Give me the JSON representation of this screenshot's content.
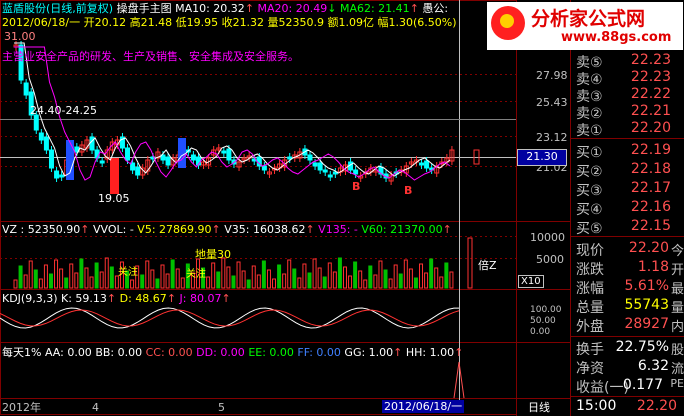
{
  "header": {
    "stock_name": "蓝盾股份(日线,前复权)",
    "chart_name": "操盘手主图",
    "ma10": "MA10: 20.32",
    "ma20": "MA20: 20.49",
    "ma62": "MA62: 21.41",
    "tail": "愚公:",
    "line2": "2012/06/18/一 开20.12 高21.48 低19.95 收21.32 量52350.9 额1.09亿 幅1.30(6.50%)",
    "business": "主营业安全产品的研发、生产及销售、安全集成及安全服务。",
    "top_price": "31.00"
  },
  "price_axis": [
    "27.98",
    "25.43",
    "23.12",
    "21.02"
  ],
  "current_price_tag": "21.30",
  "chart_annotations": {
    "range_label": "24.40-24.25",
    "low_label": "19.05",
    "b1": "B",
    "b2": "B",
    "lan_label": "地量30",
    "bei_label": "倍Z",
    "x10": "X10",
    "guanzhu1": "关注",
    "guanzhu2": "关注"
  },
  "volume_header": {
    "vz": "VZ : 52350.90",
    "vvol": "VVOL: -",
    "v5": "V5: 27869.90",
    "v35": "V35: 16038.62",
    "v135": "V135: -",
    "v60": "V60: 21370.00"
  },
  "volume_axis": [
    "10000",
    "5000"
  ],
  "kdj_header": {
    "name": "KDJ(9,3,3)",
    "k": "K: 59.13",
    "d": "D: 48.67",
    "j": "J: 80.07"
  },
  "kdj_axis": [
    "100.00",
    "50.00",
    "0.00"
  ],
  "bottom_indicator": {
    "name": "每天1%",
    "aa": "AA: 0.00",
    "bb": "BB: 0.00",
    "cc": "CC: 0.00",
    "dd": "DD: 0.00",
    "ee": "EE: 0.00",
    "ff": "FF: 0.00",
    "gg": "GG: 1.00",
    "hh": "HH: 1.00"
  },
  "time_axis": {
    "year": "2012年",
    "m4": "4",
    "m5": "5",
    "cursor_date": "2012/06/18/一",
    "period": "日线"
  },
  "watermark": {
    "brand": "分析家公式网",
    "url": "www.88gs.com"
  },
  "order_book": {
    "sell": [
      {
        "label": "卖⑤",
        "price": "22.23"
      },
      {
        "label": "卖④",
        "price": "22.23"
      },
      {
        "label": "卖③",
        "price": "22.22"
      },
      {
        "label": "卖②",
        "price": "22.21"
      },
      {
        "label": "卖①",
        "price": "22.20"
      }
    ],
    "buy": [
      {
        "label": "买①",
        "price": "22.19"
      },
      {
        "label": "买②",
        "price": "22.18"
      },
      {
        "label": "买③",
        "price": "22.17"
      },
      {
        "label": "买④",
        "price": "22.16"
      },
      {
        "label": "买⑤",
        "price": "22.15"
      }
    ]
  },
  "quote_stats": {
    "xianjia_label": "现价",
    "xianjia": "22.20",
    "xianjia_x": "今",
    "zhangdie_label": "涨跌",
    "zhangdie": "1.18",
    "zhangdie_x": "开",
    "zhangfu_label": "涨幅",
    "zhangfu": "5.61%",
    "zhangfu_x": "最",
    "zongliang_label": "总量",
    "zongliang": "55743",
    "zongliang_x": "量",
    "waipan_label": "外盘",
    "waipan": "28927",
    "waipan_x": "内",
    "huanshou_label": "换手",
    "huanshou": "22.75%",
    "huanshou_x": "股",
    "jingzi_label": "净资",
    "jingzi": "6.32",
    "jingzi_x": "流",
    "shouyi_label": "收益(一)",
    "shouyi": "0.177",
    "shouyi_x": "PE",
    "time": "15:00",
    "last_price": "22.20"
  },
  "colors": {
    "up": "#ff3232",
    "down": "#00ffff",
    "border": "#800000",
    "yellow": "#ffff00",
    "magenta": "#ff00ff"
  }
}
